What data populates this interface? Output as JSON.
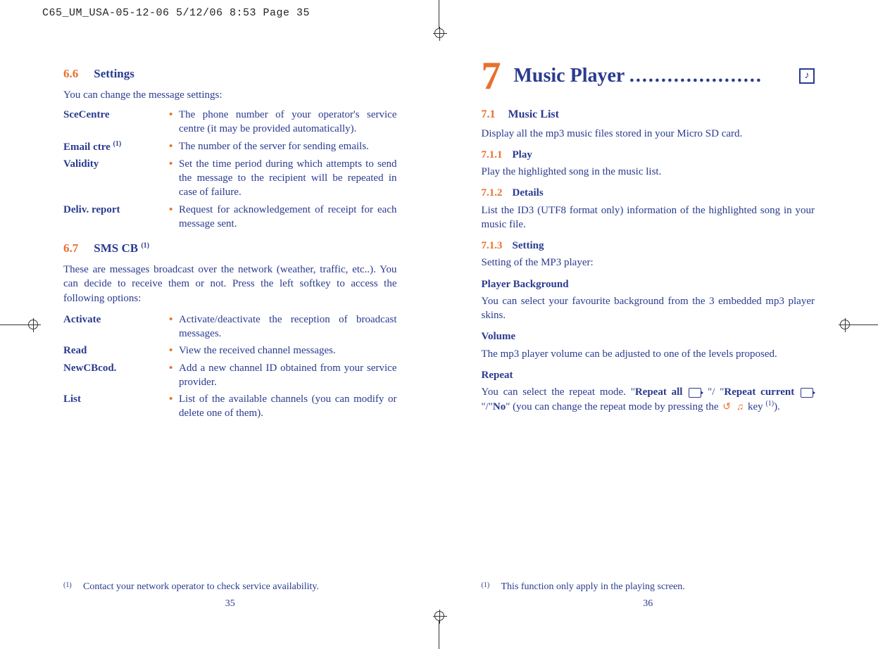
{
  "print_header": "C65_UM_USA-05-12-06  5/12/06  8:53  Page 35",
  "left": {
    "sec66_num": "6.6",
    "sec66_title": "Settings",
    "sec66_intro": "You can change the message settings:",
    "defs66": [
      {
        "term": "SceCentre",
        "desc": "The phone number of your operator's service centre (it may be provided automatically)."
      },
      {
        "term_html": "Email ctre <sup class='sup'>(1)</sup>",
        "term": "Email ctre (1)",
        "desc": "The number of the server for sending emails."
      },
      {
        "term": "Validity",
        "desc": "Set the time period during which attempts to send the message to the recipient will be repeated in case of failure."
      },
      {
        "term": "Deliv. report",
        "desc": "Request for acknowledgement of receipt for each message sent."
      }
    ],
    "sec67_num": "6.7",
    "sec67_title_html": "SMS CB <sup class='sup'>(1)</sup>",
    "sec67_title": "SMS CB (1)",
    "sec67_intro": "These are messages broadcast over the network (weather, traffic, etc..). You can decide to receive them or not. Press the left softkey to access the following options:",
    "defs67": [
      {
        "term": "Activate",
        "desc": "Activate/deactivate the reception of broadcast messages."
      },
      {
        "term": "Read",
        "desc": "View the received channel messages."
      },
      {
        "term": "NewCBcod.",
        "desc": "Add a new channel ID obtained from your service provider."
      },
      {
        "term": "List",
        "desc": "List of the available channels (you can modify or delete one of them)."
      }
    ],
    "footnote_mark": "(1)",
    "footnote": "Contact your network operator to check service availability.",
    "page_num": "35"
  },
  "right": {
    "chapter_num": "7",
    "chapter_title": "Music Player",
    "chapter_dots": ".....................",
    "music_icon_glyph": "♪",
    "sec71_num": "7.1",
    "sec71_title": "Music List",
    "sec71_intro": "Display all the mp3 music files stored in your Micro SD card.",
    "s711_num": "7.1.1",
    "s711_title": "Play",
    "s711_body": "Play the highlighted song in the music list.",
    "s712_num": "7.1.2",
    "s712_title": "Details",
    "s712_body": "List the ID3 (UTF8 format only) information of the highlighted song  in your music file.",
    "s713_num": "7.1.3",
    "s713_title": "Setting",
    "s713_body": "Setting of the MP3 player:",
    "pb_title": "Player Background",
    "pb_body": "You can select your favourite background from the 3 embedded mp3 player skins.",
    "vol_title": "Volume",
    "vol_body": "The mp3 player volume can be adjusted to one of the levels proposed.",
    "rep_title": "Repeat",
    "rep_pre": "You can select the repeat mode. \"",
    "rep_all": "Repeat all",
    "rep_mid1": " \"/ \"",
    "rep_cur": "Repeat current",
    "rep_mid2": " \"/\"",
    "rep_no": "No",
    "rep_post": "\" (you can change the repeat mode by pressing the ",
    "rep_keytext": "key ",
    "rep_sup": "(1)",
    "rep_end": ").",
    "footnote_mark": "(1)",
    "footnote": "This function only apply in the playing screen.",
    "page_num": "36"
  }
}
